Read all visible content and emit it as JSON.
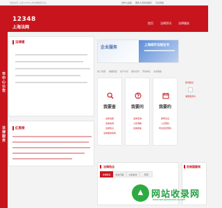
{
  "topbar": {
    "welcome": "欢迎访问 上海12348公共法律服务平台",
    "links": [
      "合作公益案",
      "服务人员风采展示",
      "平台导航"
    ]
  },
  "header": {
    "logo_number": "12348",
    "logo_name": "上海法网",
    "nav": [
      "首页",
      "法律资讯",
      "法律服务"
    ]
  },
  "ribbon": {
    "top_text": "市中心公告",
    "bottom_text": "法律服务"
  },
  "left_column": {
    "section1_title": "法律援",
    "section2_title": "红黑榜"
  },
  "banner": {
    "left_title": "企业服务",
    "right_title": "上海城市法规全书"
  },
  "tags": [
    "热门问题:",
    "婚姻家庭",
    "房产纠纷",
    "借款合同",
    "劳动争议",
    "交通事故"
  ],
  "services": [
    {
      "title": "我要查",
      "items": [
        "法律法规",
        "法律案例",
        "法律知识",
        "法律服务机构"
      ]
    },
    {
      "title": "我要问",
      "items": [
        "法律咨询",
        "人民调解",
        "法律援助"
      ]
    },
    {
      "title": "我要约",
      "items": [
        "律师见证",
        "公证预约",
        "司法鉴定预约"
      ]
    }
  ],
  "right_side": {
    "label1": "投诉建议",
    "label2": "满意度评价"
  },
  "bottom": {
    "section_title": "法律热点",
    "side_title": "民商国要闻",
    "tabs": [
      "法规解读",
      "热点问答",
      "以案说法",
      "专题"
    ]
  },
  "watermark": {
    "text": "网站收录网",
    "url": "www.wangzhanshoulu.com"
  },
  "colors": {
    "brand_red": "#c8151d",
    "watermark_green": "#24a142"
  }
}
